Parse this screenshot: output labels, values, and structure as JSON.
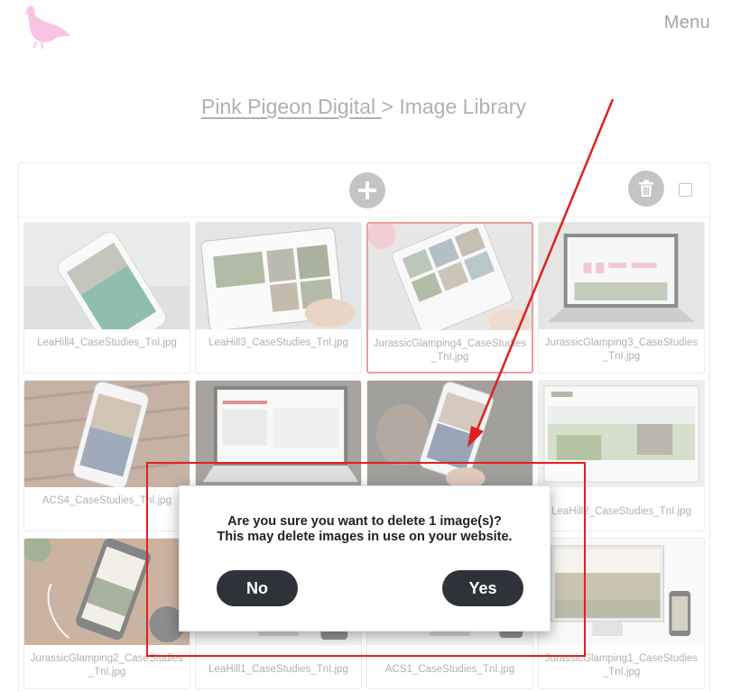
{
  "header": {
    "menu_label": "Menu",
    "logo_icon": "pink-pigeon-icon",
    "logo_color": "#f49ad0"
  },
  "breadcrumb": {
    "home": "Pink Pigeon Digital ",
    "separator": ">",
    "current": "Image Library"
  },
  "toolbar": {
    "add_icon": "plus-icon",
    "delete_icon": "trash-icon",
    "select_all_icon": "checkbox-icon"
  },
  "images": [
    {
      "name": "LeaHill4_CaseStudies_TnI.jpg"
    },
    {
      "name": "LeaHill3_CaseStudies_TnI.jpg"
    },
    {
      "name": "JurassicGlamping4_CaseStudies_TnI.jpg",
      "selected": true
    },
    {
      "name": "JurassicGlamping3_CaseStudies_TnI.jpg"
    },
    {
      "name": "ACS4_CaseStudies_TnI.jpg"
    },
    {
      "name": ""
    },
    {
      "name": ""
    },
    {
      "name": "LeaHill2_CaseStudies_TnI.jpg"
    },
    {
      "name": "JurassicGlamping2_CaseStudies_TnI.jpg"
    },
    {
      "name": "LeaHill1_CaseStudies_TnI.jpg"
    },
    {
      "name": "ACS1_CaseStudies_TnI.jpg"
    },
    {
      "name": "JurassicGlamping1_CaseStudies_TnI.jpg"
    }
  ],
  "dialog": {
    "line1": "Are you sure you want to delete 1 image(s)?",
    "line2": "This may delete images in use on your website.",
    "no_label": "No",
    "yes_label": "Yes"
  },
  "colors": {
    "button_dark": "#2f3238",
    "annotation_red": "#e02020",
    "selected_border": "#d45a5a"
  }
}
